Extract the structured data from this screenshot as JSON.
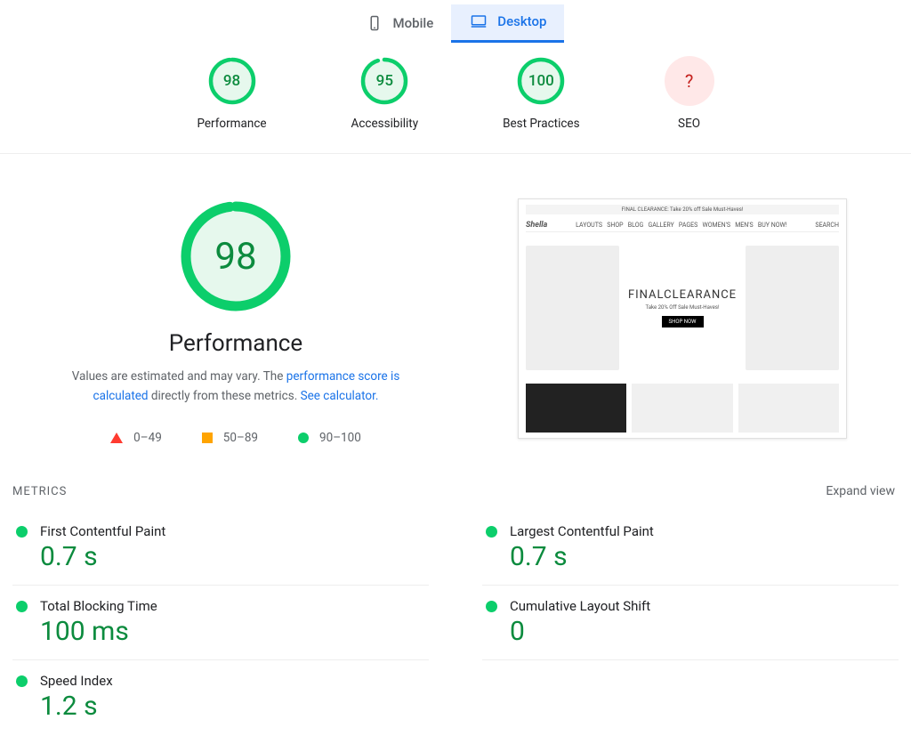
{
  "tabs": {
    "mobile": "Mobile",
    "desktop": "Desktop"
  },
  "scores": {
    "performance": {
      "value": "98",
      "label": "Performance"
    },
    "accessibility": {
      "value": "95",
      "label": "Accessibility"
    },
    "best_practices": {
      "value": "100",
      "label": "Best Practices"
    },
    "seo": {
      "value": "?",
      "label": "SEO"
    }
  },
  "detail": {
    "score": "98",
    "title": "Performance",
    "desc_before": "Values are estimated and may vary. The ",
    "desc_link1_text": "performance score is calculated",
    "desc_mid": " directly from these metrics. ",
    "desc_link2_text": "See calculator.",
    "legend": {
      "low": "0–49",
      "mid": "50–89",
      "high": "90–100"
    }
  },
  "screenshot": {
    "banner": "FINAL CLEARANCE: Take 20% off Sale Must-Haves!",
    "hero_title": "FINALCLEARANCE",
    "hero_sub": "Take 20% Off Sale Must-Haves!",
    "hero_btn": "SHOP NOW"
  },
  "metrics_section": {
    "title": "METRICS",
    "expand": "Expand view"
  },
  "metrics": {
    "fcp": {
      "name": "First Contentful Paint",
      "value": "0.7 s"
    },
    "lcp": {
      "name": "Largest Contentful Paint",
      "value": "0.7 s"
    },
    "tbt": {
      "name": "Total Blocking Time",
      "value": "100 ms"
    },
    "cls": {
      "name": "Cumulative Layout Shift",
      "value": "0"
    },
    "si": {
      "name": "Speed Index",
      "value": "1.2 s"
    }
  }
}
